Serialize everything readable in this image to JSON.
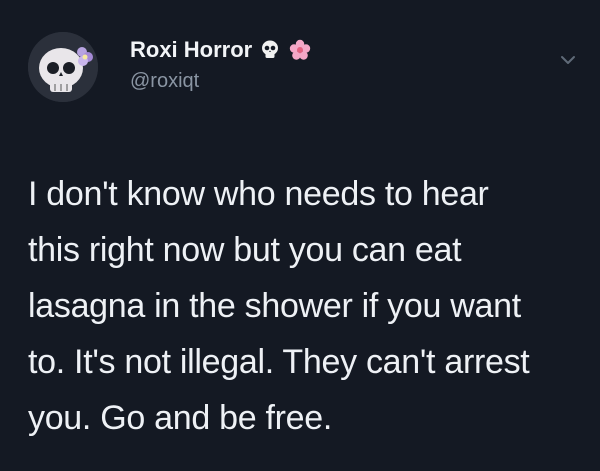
{
  "tweet": {
    "display_name": "Roxi Horror",
    "handle": "@roxiqt",
    "name_emojis": [
      "skull-icon",
      "cherry-blossom-icon"
    ],
    "avatar_icon": "skull-avatar",
    "menu_icon": "chevron-down-icon",
    "lines": [
      "I don't know who needs to hear",
      "this right now but you can eat",
      "lasagna in the shower if you want",
      "to. It's not illegal. They can't arrest",
      "you. Go and be free."
    ]
  },
  "colors": {
    "background": "#141923",
    "text": "#eef1f5",
    "handle": "#8a95a3",
    "blossom": "#f3a6c6"
  }
}
